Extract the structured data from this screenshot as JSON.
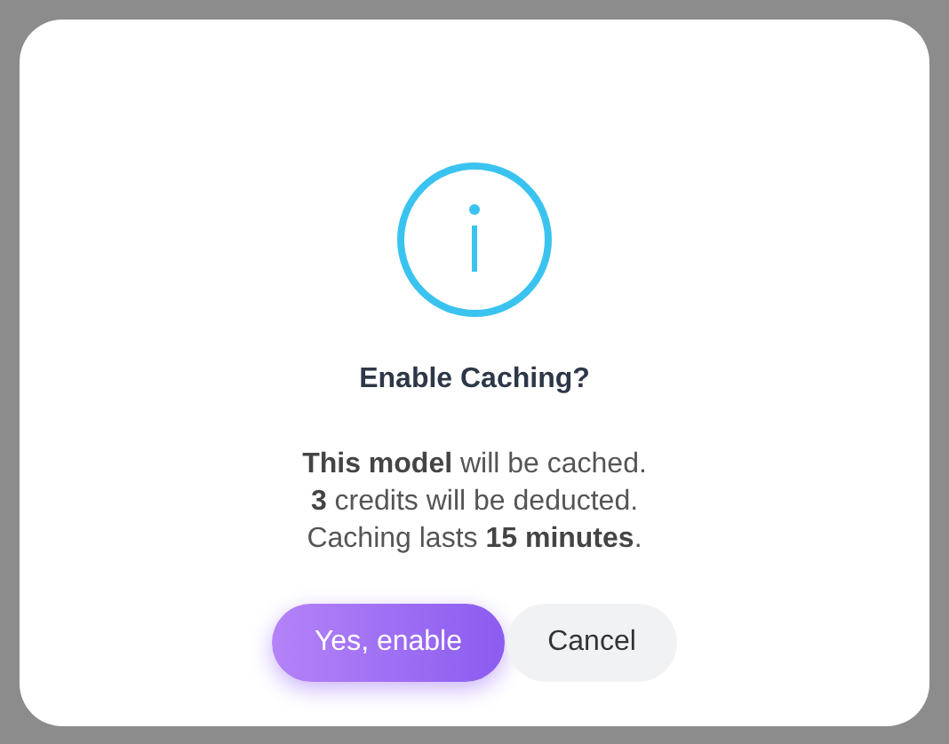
{
  "dialog": {
    "title": "Enable Caching?",
    "message_lines": [
      "**This model** will be cached.",
      "**3** credits will be deducted.",
      "Caching lasts **15 minutes**."
    ],
    "buttons": [
      {
        "label": "Yes, enable",
        "kind": "primary"
      },
      {
        "label": "Cancel",
        "kind": "secondary"
      }
    ]
  }
}
